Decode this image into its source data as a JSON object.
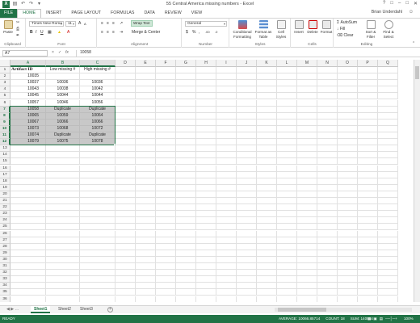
{
  "window": {
    "title": "55 Central America missing numbers - Excel",
    "user": "Brian Underdahl",
    "app_icon": "X"
  },
  "tabs": [
    "FILE",
    "HOME",
    "INSERT",
    "PAGE LAYOUT",
    "FORMULAS",
    "DATA",
    "REVIEW",
    "VIEW"
  ],
  "ribbon": {
    "clipboard": {
      "label": "Clipboard",
      "paste": "Paste"
    },
    "font": {
      "label": "Font",
      "family": "Times New Roma",
      "size": "11",
      "bold": "B",
      "italic": "I",
      "underline": "U",
      "grow": "A",
      "shrink": "A"
    },
    "alignment": {
      "label": "Alignment",
      "wrap": "Wrap Text",
      "merge": "Merge & Center"
    },
    "number": {
      "label": "Number",
      "format": "General",
      "currency": "$",
      "percent": "%",
      "comma": ",",
      "inc_dec": ".00",
      "dec_dec": ".0"
    },
    "styles": {
      "label": "Styles",
      "conditional": "Conditional Formatting",
      "format_table": "Format as Table",
      "cell_styles": "Cell Styles"
    },
    "cells": {
      "label": "Cells",
      "insert": "Insert",
      "delete": "Delete",
      "format": "Format"
    },
    "editing": {
      "label": "Editing",
      "autosum": "AutoSum",
      "fill": "Fill",
      "clear": "Clear",
      "sort": "Sort & Filter",
      "find": "Find & Select"
    }
  },
  "formula_bar": {
    "name_box": "A7",
    "cancel": "×",
    "enter": "✓",
    "fx": "fx",
    "value": "10058"
  },
  "columns": [
    "A",
    "B",
    "C",
    "D",
    "E",
    "F",
    "G",
    "H",
    "I",
    "J",
    "K",
    "L",
    "M",
    "N",
    "O",
    "P",
    "Q"
  ],
  "rows": [
    "1",
    "2",
    "3",
    "4",
    "5",
    "6",
    "7",
    "8",
    "9",
    "10",
    "11",
    "12",
    "13",
    "14",
    "15",
    "16",
    "17",
    "18",
    "19",
    "20",
    "21",
    "22",
    "23",
    "24",
    "25",
    "26",
    "27",
    "28",
    "29",
    "30",
    "31",
    "32",
    "33",
    "34",
    "35",
    "36",
    "37"
  ],
  "cells": [
    [
      "Artifact ID",
      "Low missing #",
      "High missing #"
    ],
    [
      "10035",
      "",
      ""
    ],
    [
      "10037",
      "10036",
      "10036"
    ],
    [
      "10043",
      "10038",
      "10042"
    ],
    [
      "10045",
      "10044",
      "10044"
    ],
    [
      "10057",
      "10046",
      "10056"
    ],
    [
      "10058",
      "Duplicate",
      "Duplicate"
    ],
    [
      "10065",
      "10059",
      "10064"
    ],
    [
      "10067",
      "10066",
      "10066"
    ],
    [
      "10073",
      "10068",
      "10072"
    ],
    [
      "10074",
      "Duplicate",
      "Duplicate"
    ],
    [
      "10079",
      "10075",
      "10078"
    ]
  ],
  "sheets": [
    "Sheet1",
    "Sheet2",
    "Sheet3"
  ],
  "active_sheet": "Sheet1",
  "status": {
    "ready": "READY",
    "average": "AVERAGE: 10066.85714",
    "count": "COUNT: 18",
    "sum": "SUM: 140964",
    "zoom": "100%"
  },
  "colors": {
    "accent": "#217346",
    "selection_fill": "#c8c8c8"
  }
}
